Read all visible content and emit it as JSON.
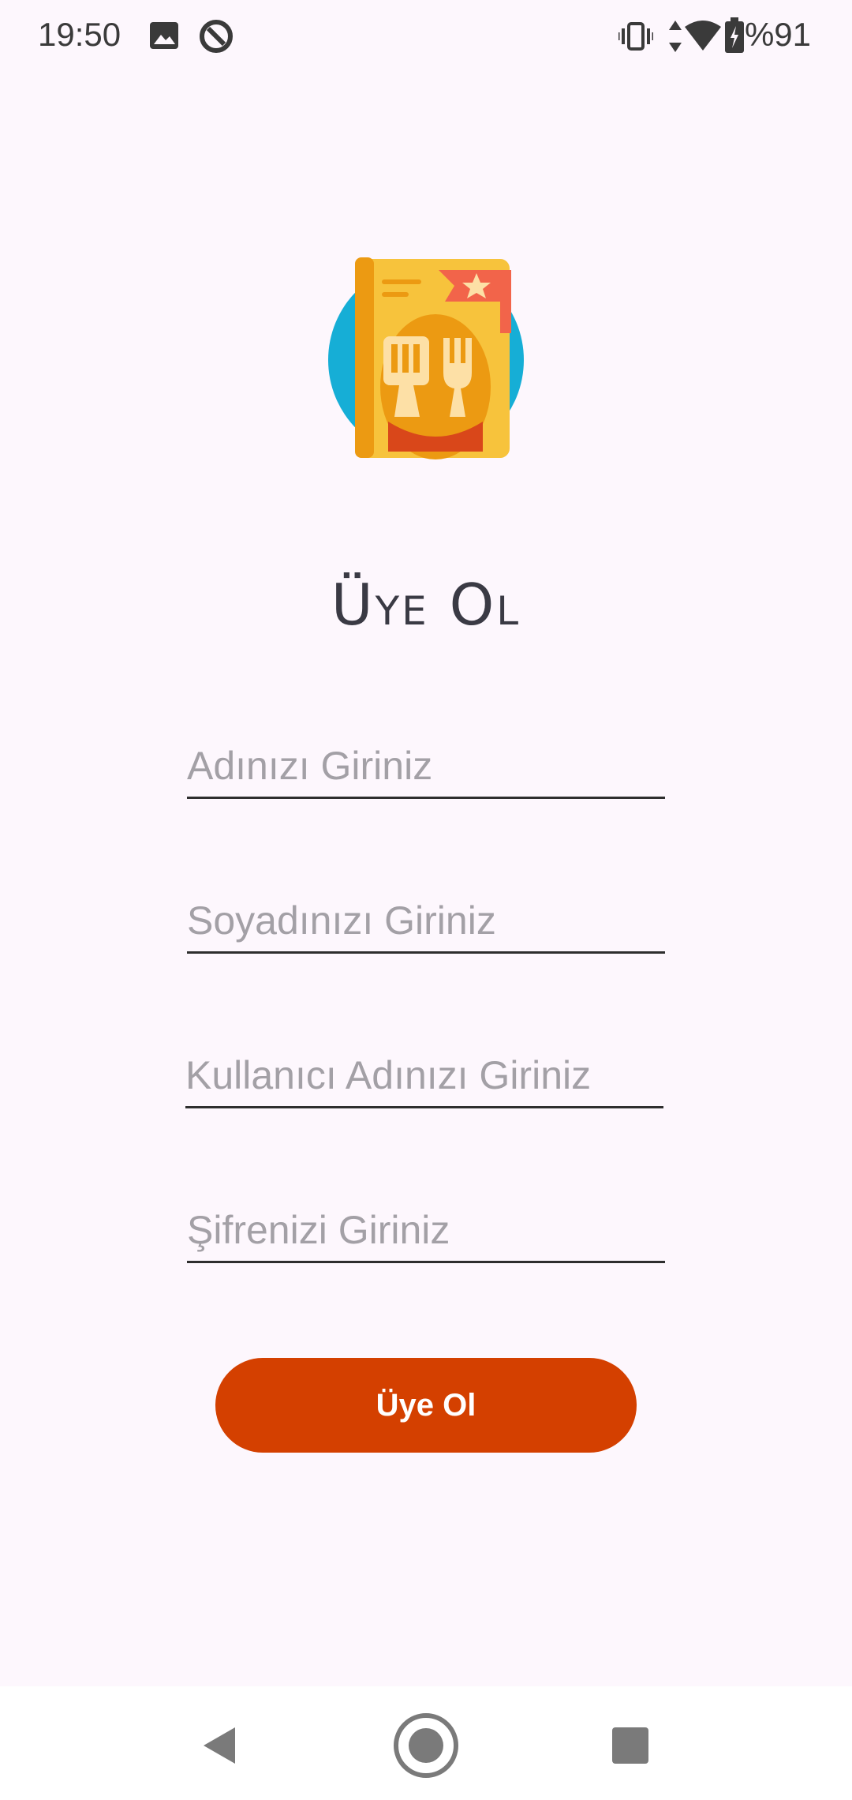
{
  "status_bar": {
    "time": "19:50",
    "battery": "%91",
    "icons": [
      "image-icon",
      "do-not-disturb-icon",
      "vibrate-icon",
      "data-arrows-icon",
      "wifi-icon",
      "battery-icon"
    ]
  },
  "logo": {
    "icon": "recipe-book-icon"
  },
  "title": "Üye Ol",
  "form": {
    "first_name_placeholder": "Adınızı Giriniz",
    "last_name_placeholder": "Soyadınızı Giriniz",
    "username_placeholder": "Kullanıcı Adınızı Giriniz",
    "password_placeholder": "Şifrenizi Giriniz",
    "submit_label": "Üye Ol"
  },
  "colors": {
    "background": "#fdf7fd",
    "button": "#d44000",
    "button_text": "#ffffff",
    "placeholder": "#a3a0a6",
    "underline": "#2e2e2e"
  },
  "nav_bar": {
    "icons": [
      "back-icon",
      "home-icon",
      "recents-icon"
    ]
  }
}
